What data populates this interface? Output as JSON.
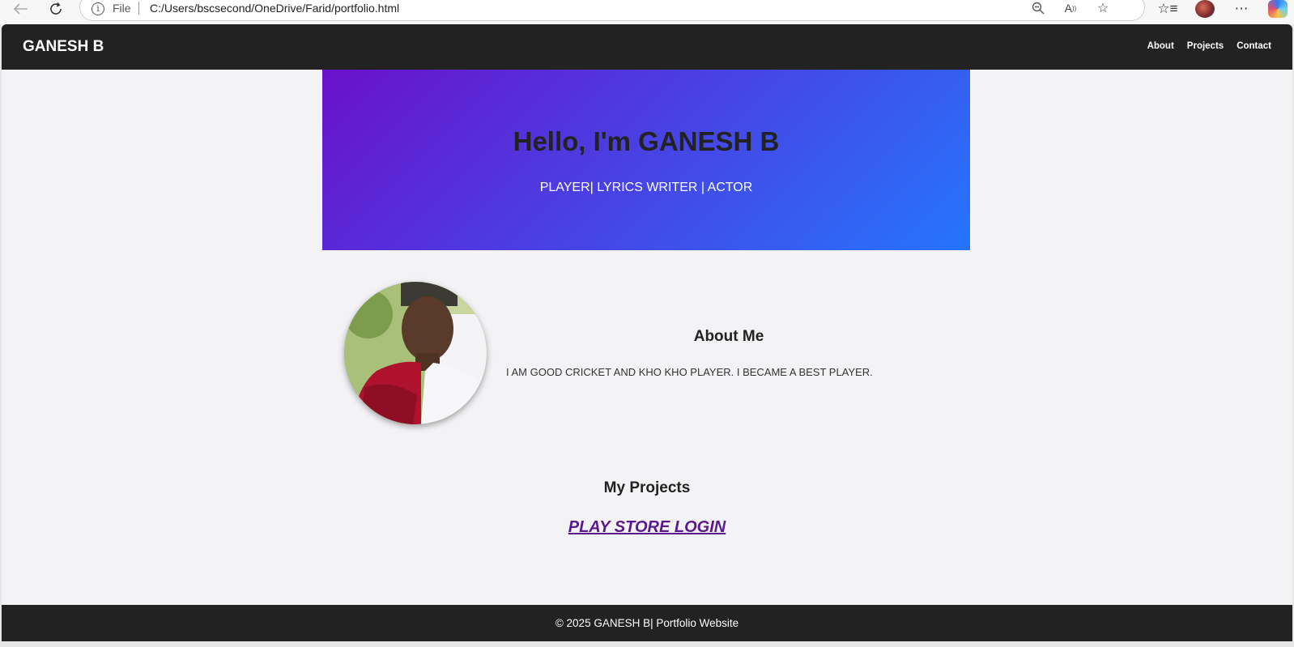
{
  "browser": {
    "address_prefix": "File",
    "url": "C:/Users/bscsecond/OneDrive/Farid/portfolio.html"
  },
  "header": {
    "logo": "GANESH B",
    "nav": [
      "About",
      "Projects",
      "Contact"
    ]
  },
  "hero": {
    "title": "Hello, I'm GANESH B",
    "subtitle": "PLAYER| LYRICS WRITER | ACTOR",
    "gradient_start": "#6a11cb",
    "gradient_end": "#2575fc"
  },
  "about": {
    "title": "About Me",
    "text": "I AM GOOD CRICKET AND KHO KHO PLAYER. I BECAME A BEST PLAYER."
  },
  "projects": {
    "title": "My Projects",
    "link_label": "PLAY STORE LOGIN"
  },
  "footer": {
    "text": "© 2025 GANESH B| Portfolio Website"
  },
  "colors": {
    "header_bg": "#222222",
    "page_bg": "#f3f3f6",
    "link_color": "#5a1a8c"
  },
  "icons": [
    "back-arrow-icon",
    "refresh-icon",
    "info-icon",
    "zoom-out-icon",
    "read-aloud-icon",
    "favorite-star-icon",
    "favorites-list-icon",
    "profile-avatar-icon",
    "more-options-icon",
    "copilot-icon"
  ]
}
